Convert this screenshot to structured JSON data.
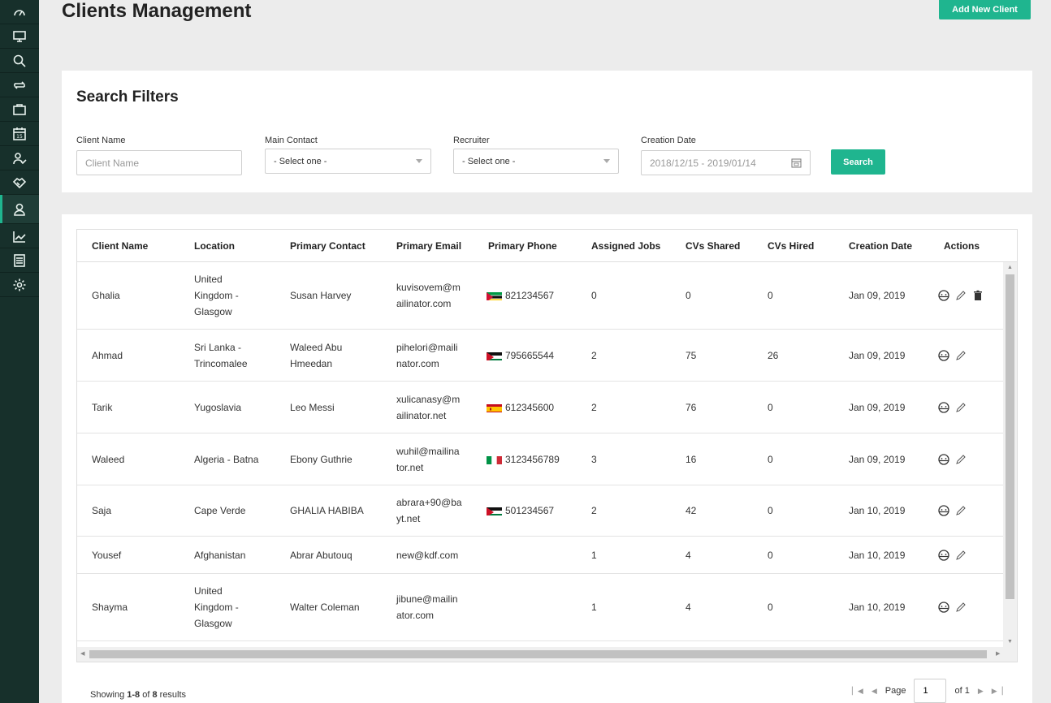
{
  "sidebar": {
    "items": [
      {
        "icon": "speedometer-icon"
      },
      {
        "icon": "monitor-icon"
      },
      {
        "icon": "search-icon"
      },
      {
        "icon": "repeat-icon"
      },
      {
        "icon": "briefcase-icon"
      },
      {
        "icon": "calendar-icon",
        "text": "15"
      },
      {
        "icon": "user-check-icon"
      },
      {
        "icon": "handshake-icon"
      },
      {
        "icon": "users-icon",
        "active": true
      },
      {
        "icon": "chart-line-icon"
      },
      {
        "icon": "document-icon"
      },
      {
        "icon": "gear-icon"
      }
    ]
  },
  "header": {
    "title": "Clients Management",
    "add_button": "Add New Client"
  },
  "filters": {
    "title": "Search Filters",
    "client_name_label": "Client Name",
    "client_name_placeholder": "Client Name",
    "main_contact_label": "Main Contact",
    "main_contact_value": "- Select one -",
    "recruiter_label": "Recruiter",
    "recruiter_value": "- Select one -",
    "creation_date_label": "Creation Date",
    "creation_date_value": "2018/12/15 - 2019/01/14",
    "search_button": "Search"
  },
  "table": {
    "columns": [
      "Client Name",
      "Location",
      "Primary Contact",
      "Primary Email",
      "Primary Phone",
      "Assigned Jobs",
      "CVs Shared",
      "CVs Hired",
      "Creation Date",
      "Actions"
    ],
    "rows": [
      {
        "name": "Ghalia",
        "location": [
          "United",
          "Kingdom -",
          "Glasgow"
        ],
        "contact": [
          "Susan Harvey"
        ],
        "email": [
          "kuvisovem@m",
          "ailinator.com"
        ],
        "flag": "mozambique",
        "phone": "821234567",
        "jobs": "0",
        "shared": "0",
        "hired": "0",
        "date": "Jan 09, 2019",
        "delete": true
      },
      {
        "name": "Ahmad",
        "location": [
          "Sri Lanka -",
          "Trincomalee"
        ],
        "contact": [
          "Waleed Abu",
          "Hmeedan"
        ],
        "email": [
          "pihelori@maili",
          "nator.com"
        ],
        "flag": "jordan",
        "phone": "795665544",
        "jobs": "2",
        "shared": "75",
        "hired": "26",
        "date": "Jan 09, 2019",
        "delete": false
      },
      {
        "name": "Tarik",
        "location": [
          "Yugoslavia"
        ],
        "contact": [
          "Leo Messi"
        ],
        "email": [
          "xulicanasy@m",
          "ailinator.net"
        ],
        "flag": "spain",
        "phone": "612345600",
        "jobs": "2",
        "shared": "76",
        "hired": "0",
        "date": "Jan 09, 2019",
        "delete": false
      },
      {
        "name": "Waleed",
        "location": [
          "Algeria - Batna"
        ],
        "contact": [
          "Ebony Guthrie"
        ],
        "email": [
          "wuhil@mailina",
          "tor.net"
        ],
        "flag": "italy",
        "phone": "3123456789",
        "jobs": "3",
        "shared": "16",
        "hired": "0",
        "date": "Jan 09, 2019",
        "delete": false
      },
      {
        "name": "Saja",
        "location": [
          "Cape Verde"
        ],
        "contact": [
          "GHALIA HABIBA"
        ],
        "email": [
          "abrara+90@ba",
          "yt.net"
        ],
        "flag": "jordan",
        "phone": "501234567",
        "jobs": "2",
        "shared": "42",
        "hired": "0",
        "date": "Jan 10, 2019",
        "delete": false
      },
      {
        "name": "Yousef",
        "location": [
          "Afghanistan"
        ],
        "contact": [
          "Abrar Abutouq"
        ],
        "email": [
          "new@kdf.com"
        ],
        "flag": "",
        "phone": "",
        "jobs": "1",
        "shared": "4",
        "hired": "0",
        "date": "Jan 10, 2019",
        "delete": false
      },
      {
        "name": "Shayma",
        "location": [
          "United",
          "Kingdom -",
          "Glasgow"
        ],
        "contact": [
          "Walter Coleman"
        ],
        "email": [
          "jibune@mailin",
          "ator.com"
        ],
        "flag": "",
        "phone": "",
        "jobs": "1",
        "shared": "4",
        "hired": "0",
        "date": "Jan 10, 2019",
        "delete": false
      }
    ]
  },
  "footer": {
    "showing_prefix": "Showing ",
    "showing_range": "1-8",
    "showing_of": " of ",
    "showing_total": "8",
    "showing_suffix": " results",
    "page_label": "Page",
    "page_value": "1",
    "of_pages": "of 1"
  },
  "colors": {
    "accent": "#1fb58f",
    "sidebar": "#17302b"
  }
}
